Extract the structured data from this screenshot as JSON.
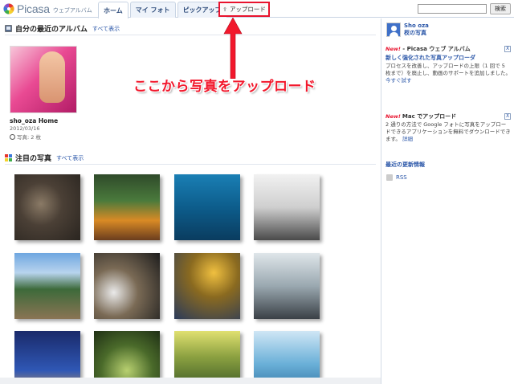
{
  "header": {
    "logo_text": "Picasa",
    "logo_sub": "ウェブアルバム",
    "tabs": [
      {
        "label": "ホーム"
      },
      {
        "label": "マイ フォト"
      },
      {
        "label": "ピックアップ"
      }
    ],
    "upload_label": "アップロード",
    "search_placeholder": "",
    "search_button": "検索"
  },
  "recent": {
    "title": "自分の最近のアルバム",
    "show_all": "すべて表示",
    "album": {
      "name": "sho_oza Home",
      "date": "2012/03/16",
      "count": "写真: 2 枚"
    }
  },
  "annotation": {
    "text": "ここから写真をアップロード",
    "color": "#f2182c"
  },
  "featured": {
    "title": "注目の写真",
    "show_all": "すべて表示"
  },
  "sidebar": {
    "user_name": "Sho oza",
    "user_photos": "杈の写真",
    "box1": {
      "new_label": "New!",
      "title": " - Picasa ウェブ アルバム",
      "link": "新しく強化された写真アップローダ",
      "body": "プロセスを改善し、アップロードの上限（1 回で 5 枚まで）を廃止し、動画のサポートを追加しました。",
      "more": "今すぐ試す",
      "close": "X"
    },
    "box2": {
      "new_label": "New!",
      "title": "Mac でアップロード",
      "body": "2 通りの方法で Google フォトに写真をアップロードできるアプリケーションを無料でダウンロードできます。",
      "more": "詳細",
      "close": "X"
    },
    "updates": "最近の更新情報",
    "rss": "RSS"
  }
}
